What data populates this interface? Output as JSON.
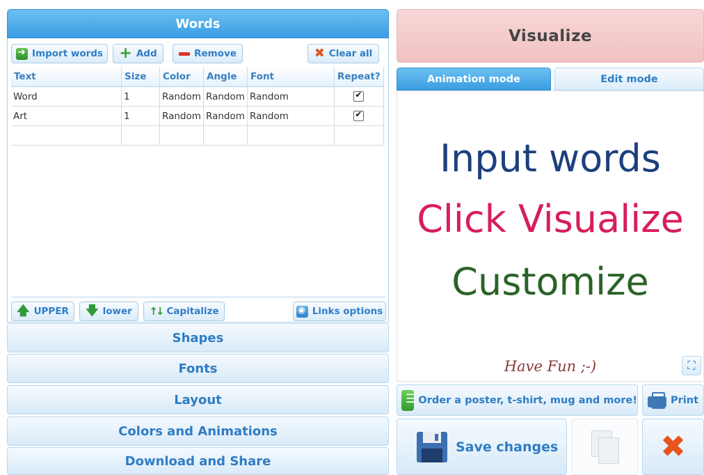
{
  "words_panel": {
    "title": "Words",
    "toolbar": {
      "import": "Import words",
      "add": "Add",
      "remove": "Remove",
      "clear": "Clear all"
    },
    "columns": [
      "Text",
      "Size",
      "Color",
      "Angle",
      "Font",
      "Repeat?"
    ],
    "rows": [
      {
        "text": "Word",
        "size": "1",
        "color": "Random",
        "angle": "Random",
        "font": "Random",
        "repeat": true
      },
      {
        "text": "Art",
        "size": "1",
        "color": "Random",
        "angle": "Random",
        "font": "Random",
        "repeat": true
      }
    ],
    "case_buttons": {
      "upper": "UPPER",
      "lower": "lower",
      "capitalize": "Capitalize",
      "links": "Links options"
    }
  },
  "sections": {
    "shapes": "Shapes",
    "fonts": "Fonts",
    "layout": "Layout",
    "colors": "Colors and Animations",
    "download": "Download and Share"
  },
  "right_panel": {
    "visualize": "Visualize",
    "tabs": {
      "animation": "Animation mode",
      "edit": "Edit mode",
      "active": "animation"
    },
    "canvas_text": {
      "line1": "Input words",
      "line2": "Click Visualize",
      "line3": "Customize",
      "line4": "Have Fun ;-)"
    },
    "order": "Order a poster, t-shirt, mug and more!",
    "print": "Print",
    "save": "Save changes"
  },
  "icons": {
    "import": "import-icon",
    "add": "plus-icon",
    "remove": "minus-icon",
    "clear": "x-icon",
    "upper": "arrow-up-icon",
    "lower": "arrow-down-icon",
    "capitalize": "arrows-updown-icon",
    "links": "link-icon",
    "fullscreen": "fullscreen-icon",
    "order": "cart-icon",
    "print": "printer-icon",
    "save": "floppy-icon",
    "copy": "copy-icon",
    "delete": "x-icon"
  },
  "colors": {
    "accent_blue": "#3a9de2",
    "visualize_bg": "#f1c2c2",
    "line1": "#1d3f7e",
    "line2": "#d81e58",
    "line3": "#2b6327"
  }
}
